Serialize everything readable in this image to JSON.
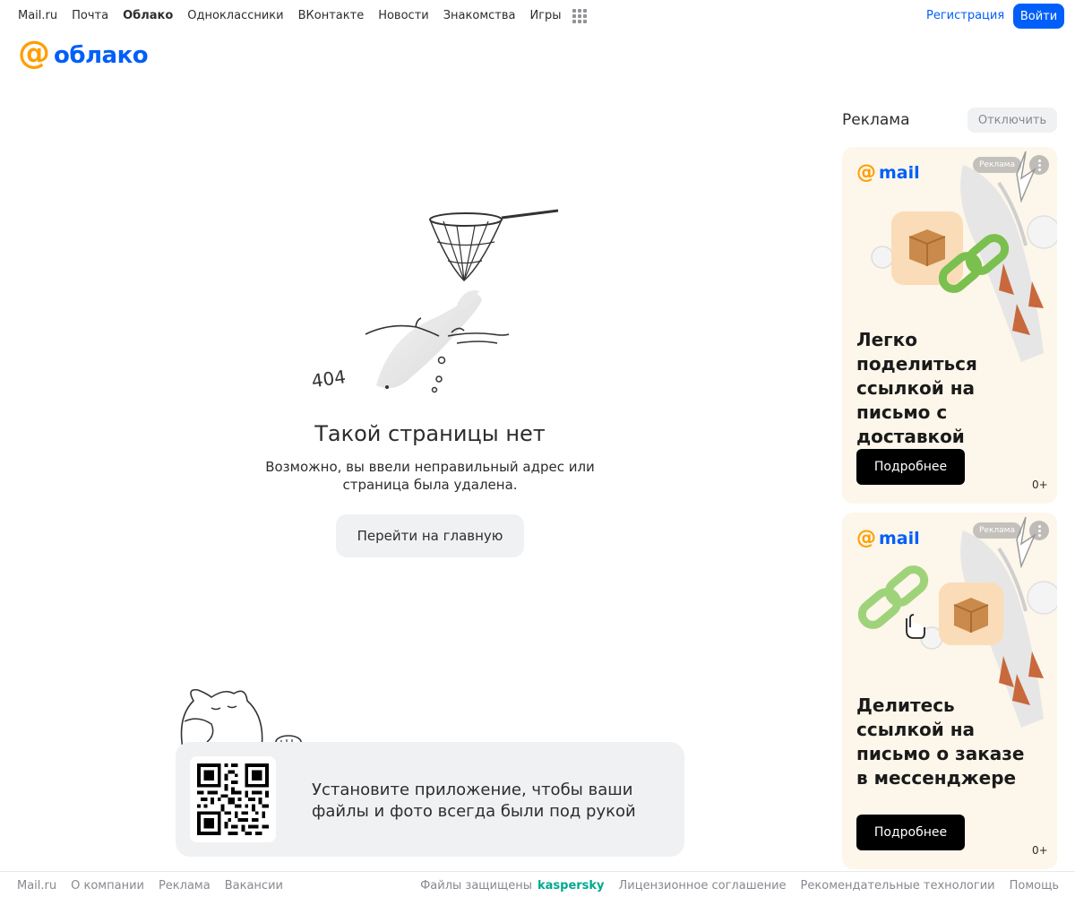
{
  "topnav": {
    "links": [
      "Mail.ru",
      "Почта",
      "Облако",
      "Одноклассники",
      "ВКонтакте",
      "Новости",
      "Знакомства",
      "Игры"
    ],
    "active": "Облако",
    "register_label": "Регистрация",
    "login_label": "Войти"
  },
  "logo": {
    "at": "@",
    "word": "облако"
  },
  "error": {
    "code": "404",
    "title": "Такой страницы нет",
    "text_line1": "Возможно, вы ввели неправильный адрес или",
    "text_line2": "страница была удалена.",
    "home_button": "Перейти на главную"
  },
  "promo": {
    "line1": "Установите приложение, чтобы ваши",
    "line2": "файлы и фото всегда были под рукой"
  },
  "ads": {
    "title": "Реклама",
    "disable_label": "Отключить",
    "cards": [
      {
        "brand_at": "@",
        "brand_word": "mail",
        "badge": "Реклама",
        "headline": "Легко поделиться ссылкой на письмо с доставкой",
        "cta": "Подробнее",
        "age": "0+"
      },
      {
        "brand_at": "@",
        "brand_word": "mail",
        "badge": "Реклама",
        "headline": "Делитесь ссылкой на письмо о заказе в мессенджере",
        "cta": "Подробнее",
        "age": "0+"
      }
    ]
  },
  "footer": {
    "left": [
      "Mail.ru",
      "О компании",
      "Реклама",
      "Вакансии"
    ],
    "protected": "Файлы защищены",
    "kaspersky": "kaspersky",
    "right": [
      "Лицензионное соглашение",
      "Рекомендательные технологии",
      "Помощь"
    ]
  },
  "colors": {
    "accent": "#005ff9",
    "brand_orange": "#ff9e00",
    "kaspersky": "#00a88e",
    "ad_bg": "#fdf6ea"
  }
}
